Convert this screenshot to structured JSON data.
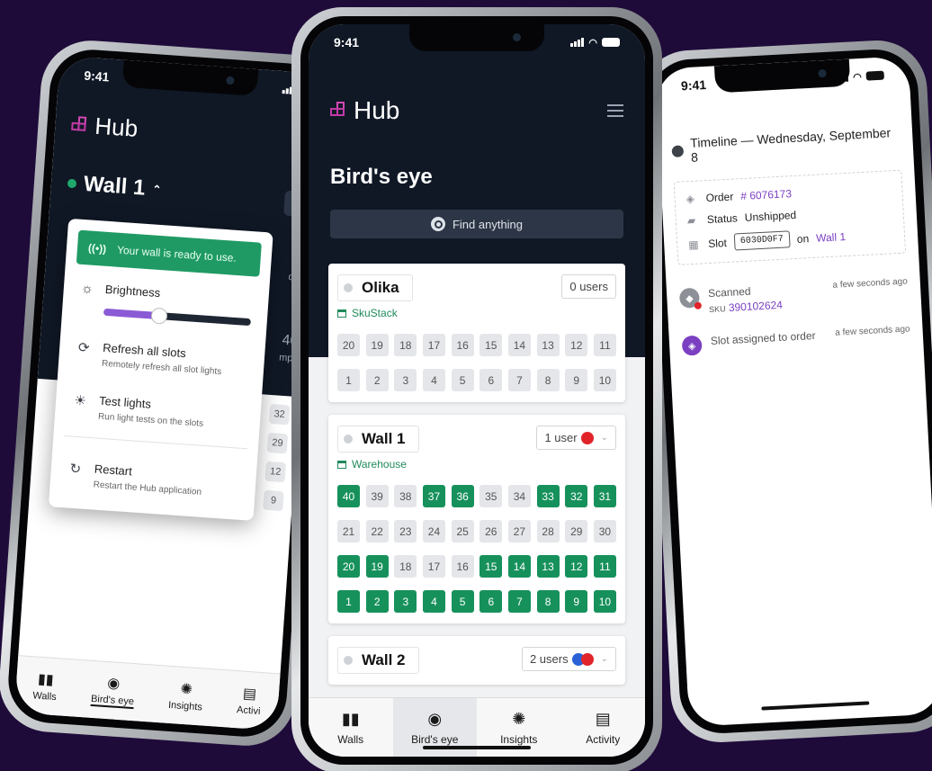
{
  "colors": {
    "background": "#1f0b3a",
    "dark": "#101826",
    "green": "#17915c",
    "purple": "#7b3fc2"
  },
  "left": {
    "time": "9:41",
    "brand": "Hub",
    "wall_title": "Wall 1",
    "ready": "Your wall is ready to use.",
    "brightness": "Brightness",
    "brightness_level": 0.38,
    "refresh_title": "Refresh all slots",
    "refresh_sub": "Remotely refresh all slot lights",
    "test_title": "Test lights",
    "test_sub": "Run light tests on the slots",
    "restart_title": "Restart",
    "restart_sub": "Restart the Hub application",
    "snip_des": "des",
    "snip_num": "40",
    "snip_empty": "mpty",
    "grid": [
      [
        "32"
      ],
      [
        "29"
      ],
      [
        "12"
      ],
      [
        "9"
      ]
    ],
    "tabs": [
      "Walls",
      "Bird's eye",
      "Insights",
      "Activi"
    ]
  },
  "center": {
    "time": "9:41",
    "brand": "Hub",
    "title": "Bird's eye",
    "search": "Find anything",
    "cards": [
      {
        "name": "Olika",
        "location": "SkuStack",
        "users": "0 users",
        "rows": [
          [
            20,
            19,
            18,
            17,
            16,
            15,
            14,
            13,
            12,
            11
          ],
          [
            1,
            2,
            3,
            4,
            5,
            6,
            7,
            8,
            9,
            10
          ]
        ],
        "active": [
          [],
          []
        ]
      },
      {
        "name": "Wall 1",
        "location": "Warehouse",
        "users": "1 user",
        "rows": [
          [
            40,
            39,
            38,
            37,
            36,
            35,
            34,
            33,
            32,
            31
          ],
          [
            21,
            22,
            23,
            24,
            25,
            26,
            27,
            28,
            29,
            30
          ],
          [
            20,
            19,
            18,
            17,
            16,
            15,
            14,
            13,
            12,
            11
          ],
          [
            1,
            2,
            3,
            4,
            5,
            6,
            7,
            8,
            9,
            10
          ]
        ],
        "active": [
          [
            40,
            37,
            36,
            33,
            32,
            31
          ],
          [],
          [
            20,
            19,
            15,
            14,
            13,
            12,
            11
          ],
          [
            1,
            2,
            3,
            4,
            5,
            6,
            7,
            8,
            9,
            10
          ]
        ]
      },
      {
        "name": "Wall 2",
        "users": "2 users"
      }
    ],
    "tabs": [
      "Walls",
      "Bird's eye",
      "Insights",
      "Activity"
    ]
  },
  "right": {
    "time": "9:41",
    "timeline_title": "Timeline — Wednesday, September 8",
    "order_label": "Order",
    "order_num": "# 6076173",
    "status_label": "Status",
    "status_value": "Unshipped",
    "slot_label": "Slot",
    "slot_code": "6030D0F7",
    "on_label": "on",
    "slot_wall": "Wall 1",
    "events": [
      {
        "title": "Scanned",
        "sku_label": "SKU",
        "sku": "390102624",
        "time": "a few seconds ago"
      },
      {
        "title": "Slot assigned to order",
        "time": "a few seconds ago"
      }
    ]
  }
}
